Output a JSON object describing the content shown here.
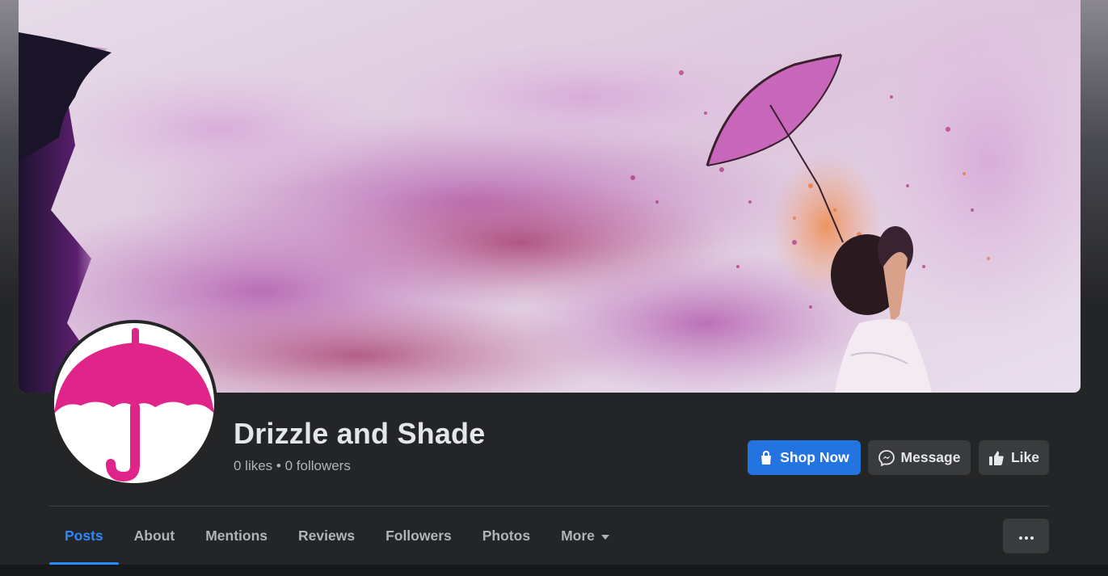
{
  "page": {
    "name": "Drizzle and Shade",
    "stats": "0 likes • 0 followers"
  },
  "actions": {
    "shop_now": "Shop Now",
    "message": "Message",
    "like": "Like"
  },
  "tabs": [
    {
      "label": "Posts",
      "active": true
    },
    {
      "label": "About",
      "active": false
    },
    {
      "label": "Mentions",
      "active": false
    },
    {
      "label": "Reviews",
      "active": false
    },
    {
      "label": "Followers",
      "active": false
    },
    {
      "label": "Photos",
      "active": false
    },
    {
      "label": "More",
      "active": false
    }
  ],
  "colors": {
    "accent": "#2374e1",
    "active_tab": "#2d88ff",
    "logo_pink": "#e0258a",
    "panel": "#242526"
  },
  "icons": {
    "shop": "shopping-bag-icon",
    "message": "messenger-icon",
    "like": "thumbs-up-icon",
    "more_caret": "caret-down-icon",
    "more_options": "ellipsis-icon"
  }
}
